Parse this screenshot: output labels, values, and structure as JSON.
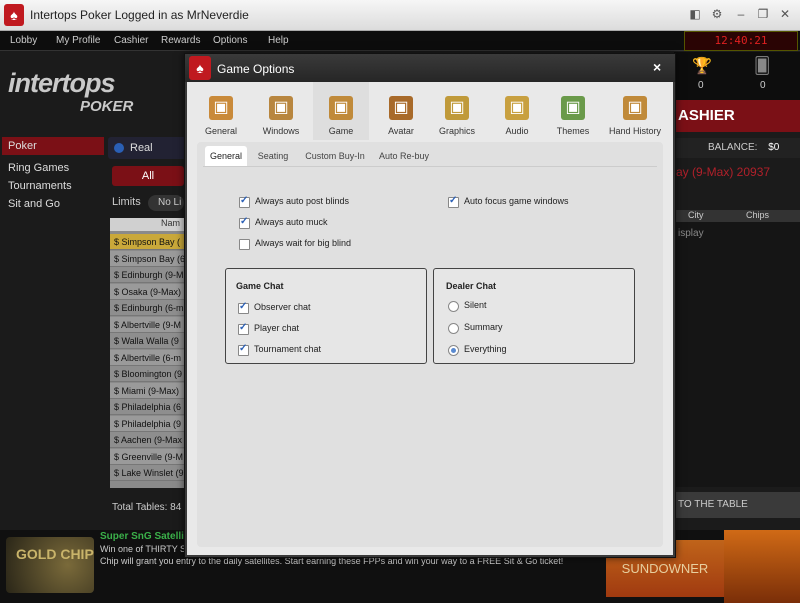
{
  "window": {
    "title": "Intertops Poker Logged in as MrNeverdie"
  },
  "menu": [
    "Lobby",
    "My Profile",
    "Cashier",
    "Rewards",
    "Options",
    "Help"
  ],
  "clock": "12:40:21",
  "brand": {
    "line1": "intertops",
    "line2": "POKER"
  },
  "sidebar": {
    "items": [
      "Poker",
      "Ring Games",
      "Tournaments",
      "Sit and Go"
    ]
  },
  "lobby": {
    "real_money": "Real money",
    "all": "All",
    "limits": "Limits",
    "no_limit": "No Li",
    "name_header": "Nam",
    "tables": [
      "$ Simpson Bay (",
      "$ Simpson Bay (6",
      "$ Edinburgh (9-M",
      "$ Osaka (9-Max)",
      "$ Edinburgh (6-m",
      "$ Albertville (9-M",
      "$ Walla Walla (9",
      "$ Albertville (6-m",
      "$ Bloomington (9",
      "$ Miami (9-Max)",
      "$ Philadelphia (6",
      "$ Philadelphia (9",
      "$ Aachen (9-Max",
      "$ Greenville (9-M",
      "$ Lake Winslet (9"
    ],
    "total_tables": "Total Tables: 84"
  },
  "right": {
    "counts": [
      "0",
      "0"
    ],
    "cashier": "ASHIER",
    "balance_label": "BALANCE:",
    "balance_value": "$0",
    "table_title": "ay (9-Max) 20937",
    "col_city": "City",
    "col_chips": "Chips",
    "display_text": "isplay",
    "to_table": "TO THE TABLE"
  },
  "promo": {
    "gold_chip": "GOLD CHIP",
    "title": "Super SnG Satelli",
    "line1": "Win one of THIRTY S",
    "line2": "Chip will grant you entry to the daily satellites. Start earning these FPPs and win your way to a FREE Sit & Go ticket!",
    "sundowner": "SUNDOWNER"
  },
  "dialog": {
    "title": "Game Options",
    "close": "×",
    "categories": [
      {
        "label": "General",
        "icon": "general-icon",
        "color": "#c98a3a"
      },
      {
        "label": "Windows",
        "icon": "windows-icon",
        "color": "#b8863f"
      },
      {
        "label": "Game",
        "icon": "game-icon",
        "color": "#c08a3a"
      },
      {
        "label": "Avatar",
        "icon": "avatar-icon",
        "color": "#a86a2a"
      },
      {
        "label": "Graphics",
        "icon": "graphics-icon",
        "color": "#c09a3a"
      },
      {
        "label": "Audio",
        "icon": "audio-icon",
        "color": "#c8a040"
      },
      {
        "label": "Themes",
        "icon": "themes-icon",
        "color": "#6a9a4a"
      },
      {
        "label": "Hand History",
        "icon": "hand-history-icon",
        "color": "#c08a3a"
      }
    ],
    "subtabs": [
      "General",
      "Seating",
      "Custom Buy-In",
      "Auto Re-buy"
    ],
    "options_left": [
      {
        "label": "Always auto post blinds",
        "checked": true
      },
      {
        "label": "Always auto muck",
        "checked": true
      },
      {
        "label": "Always wait for big blind",
        "checked": false
      }
    ],
    "options_right": [
      {
        "label": "Auto focus game windows",
        "checked": true
      }
    ],
    "game_chat": {
      "title": "Game Chat",
      "items": [
        {
          "label": "Observer chat",
          "checked": true
        },
        {
          "label": "Player chat",
          "checked": true
        },
        {
          "label": "Tournament chat",
          "checked": true
        }
      ]
    },
    "dealer_chat": {
      "title": "Dealer Chat",
      "items": [
        {
          "label": "Silent",
          "checked": false
        },
        {
          "label": "Summary",
          "checked": false
        },
        {
          "label": "Everything",
          "checked": true
        }
      ]
    }
  }
}
